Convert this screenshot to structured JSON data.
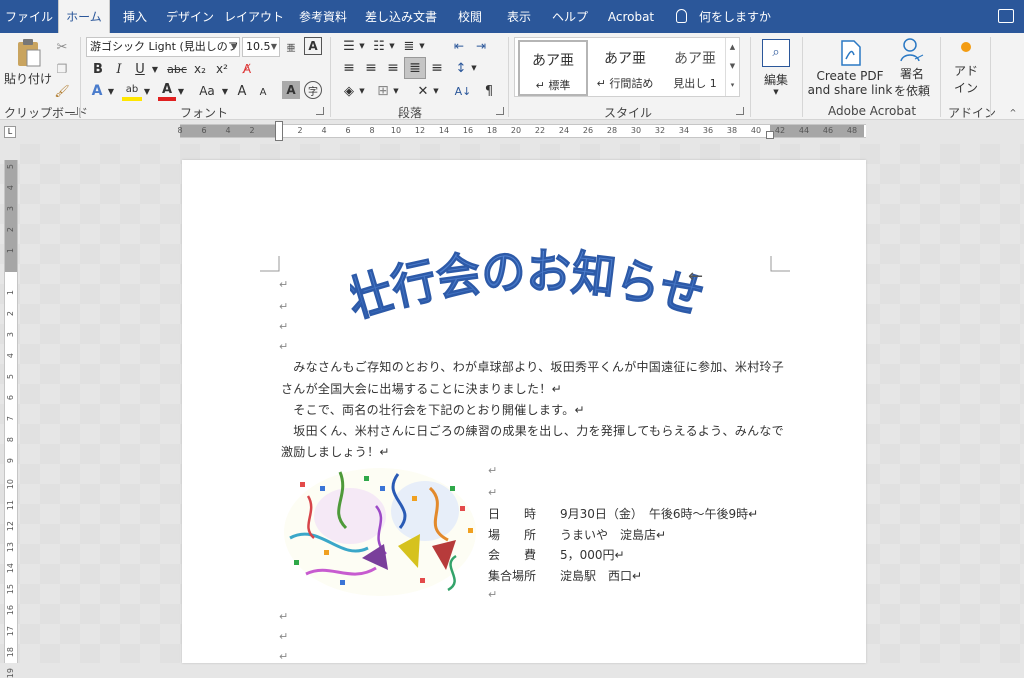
{
  "menu": {
    "tabs": [
      "ファイル",
      "ホーム",
      "挿入",
      "デザイン",
      "レイアウト",
      "参考資料",
      "差し込み文書",
      "校閲",
      "表示",
      "ヘルプ",
      "Acrobat"
    ],
    "active": "ホーム",
    "tell_me": "何をしますか"
  },
  "ribbon": {
    "clipboard": {
      "paste": "貼り付け",
      "label": "クリップボード"
    },
    "font": {
      "name": "游ゴシック Light (見出しのフ",
      "size": "10.5",
      "label": "フォント",
      "bold": "B",
      "italic": "I",
      "underline": "U",
      "strike": "abc",
      "sub": "x₂",
      "sup": "x²",
      "grow": "A",
      "shrink": "A",
      "case": "Aa"
    },
    "paragraph": {
      "label": "段落"
    },
    "styles": {
      "label": "スタイル",
      "items": [
        {
          "preview": "あア亜",
          "name": "↵ 標準"
        },
        {
          "preview": "あア亜",
          "name": "↵ 行間詰め"
        },
        {
          "preview": "あア亜",
          "name": "見出し 1"
        }
      ]
    },
    "editing": {
      "label": "編集"
    },
    "acrobat": {
      "create": "Create PDF",
      "share": "and share link",
      "sign1": "署名",
      "sign2": "を依頼",
      "label": "Adobe Acrobat"
    },
    "addin": {
      "line1": "アド",
      "line2": "イン",
      "label": "アドイン"
    }
  },
  "ruler": {
    "h": [
      "8",
      "6",
      "4",
      "2",
      "",
      "2",
      "4",
      "6",
      "8",
      "10",
      "12",
      "14",
      "16",
      "18",
      "20",
      "22",
      "24",
      "26",
      "28",
      "30",
      "32",
      "34",
      "36",
      "38",
      "40",
      "42",
      "44",
      "46",
      "48"
    ],
    "v": [
      "5",
      "4",
      "3",
      "2",
      "1",
      "",
      "1",
      "2",
      "3",
      "4",
      "5",
      "6",
      "7",
      "8",
      "9",
      "10",
      "11",
      "12",
      "13",
      "14",
      "15",
      "16",
      "17",
      "18",
      "19"
    ]
  },
  "doc": {
    "title": "壮行会のお知らせ",
    "mark": "↵",
    "lines": [
      "　みなさんもご存知のとおり、わが卓球部より、坂田秀平くんが中国遠征に参加、米村玲子",
      "さんが全国大会に出場することに決まりました！↵",
      "　そこで、両名の壮行会を下記のとおり開催します。↵",
      "　坂田くん、米村さんに日ごろの練習の成果を出し、力を発揮してもらえるよう、みんなで",
      "激励しましょう！↵"
    ],
    "info": [
      {
        "label": "日　　時",
        "value": "9月30日（金）　午後6時～午後9時↵"
      },
      {
        "label": "場　　所",
        "value": "うまいや　淀島店↵"
      },
      {
        "label": "会　　費",
        "value": "5，000円↵"
      },
      {
        "label": "集合場所",
        "value": "淀島駅　西口↵"
      }
    ]
  },
  "colors": {
    "accent": "#2b579a",
    "wordart": "#3a6fc4"
  }
}
